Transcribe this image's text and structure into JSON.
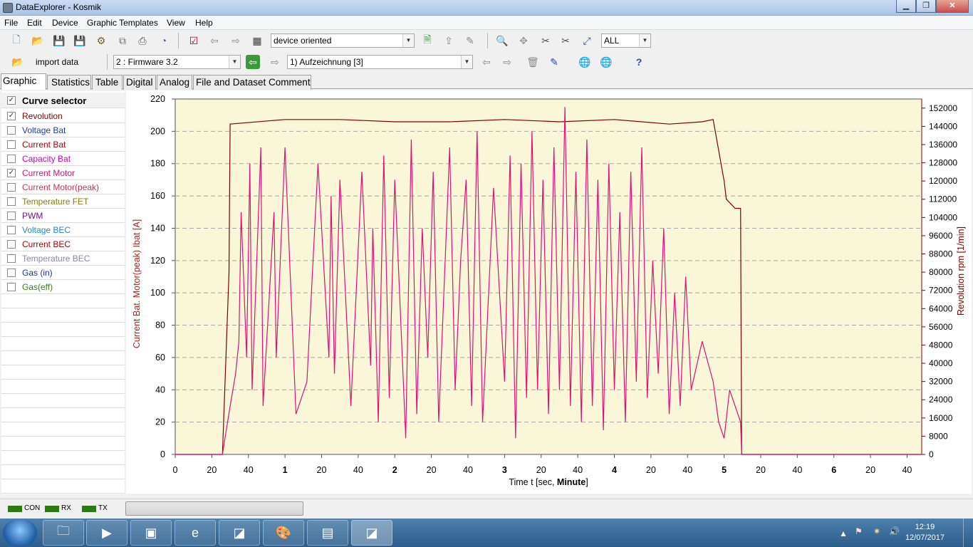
{
  "window": {
    "title": "DataExplorer  -  Kosmik",
    "minimize": "▁",
    "maximize": "❐",
    "close": "✕"
  },
  "menu": [
    "File",
    "Edit",
    "Device",
    "Graphic Templates",
    "View",
    "Help"
  ],
  "toolbar": {
    "device_mode": "device oriented",
    "zoom_filter": "ALL",
    "import_label": "import data",
    "channel": "2 : Firmware 3.2",
    "record": "1) Aufzeichnung [3]"
  },
  "tabs": [
    "Graphic",
    "Statistics",
    "Table",
    "Digital",
    "Analog",
    "File and Dataset Comment"
  ],
  "curve_selector": {
    "header": "Curve selector",
    "items": [
      {
        "label": "Revolution",
        "checked": true,
        "color": "#7f0000"
      },
      {
        "label": "Voltage Bat",
        "checked": false,
        "color": "#1c3bb5"
      },
      {
        "label": "Current Bat",
        "checked": false,
        "color": "#b00000"
      },
      {
        "label": "Capacity Bat",
        "checked": false,
        "color": "#d000c0"
      },
      {
        "label": "Current Motor",
        "checked": true,
        "color": "#cc1177"
      },
      {
        "label": "Current Motor(peak)",
        "checked": false,
        "color": "#cc3355"
      },
      {
        "label": "Temperature FET",
        "checked": false,
        "color": "#8a7a10"
      },
      {
        "label": "PWM",
        "checked": false,
        "color": "#7a1090"
      },
      {
        "label": "Voltage BEC",
        "checked": false,
        "color": "#2288cc"
      },
      {
        "label": "Current BEC",
        "checked": false,
        "color": "#b00000"
      },
      {
        "label": "Temperature BEC",
        "checked": false,
        "color": "#8888a8"
      },
      {
        "label": "Gas (in)",
        "checked": false,
        "color": "#203090"
      },
      {
        "label": "Gas(eff)",
        "checked": false,
        "color": "#3c7a1a"
      }
    ]
  },
  "chart_data": {
    "type": "line",
    "xlabel": "Time   t   [sec,",
    "xlabel_unit": "Minute",
    "xlabel_end": "]",
    "ylabel_left": "Current Bat. Motor(peak)  Ibat  [A]",
    "ylabel_right": "Revolution  rpm  [1/min]",
    "x_ticks": [
      "0",
      "20",
      "40",
      "1",
      "20",
      "40",
      "2",
      "20",
      "40",
      "3",
      "20",
      "40",
      "4",
      "20",
      "40",
      "5",
      "20",
      "40",
      "6",
      "20",
      "40"
    ],
    "x_tick_bold": [
      false,
      false,
      false,
      true,
      false,
      false,
      true,
      false,
      false,
      true,
      false,
      false,
      true,
      false,
      false,
      true,
      false,
      false,
      true,
      false,
      false
    ],
    "xlim": [
      0,
      6.8
    ],
    "ylim_left": [
      0,
      220
    ],
    "y_ticks_left": [
      0,
      20,
      40,
      60,
      80,
      100,
      120,
      140,
      160,
      180,
      200,
      220
    ],
    "ylim_right": [
      0,
      156000
    ],
    "y_ticks_right": [
      0,
      8000,
      16000,
      24000,
      32000,
      40000,
      48000,
      56000,
      64000,
      72000,
      80000,
      88000,
      96000,
      104000,
      112000,
      120000,
      128000,
      136000,
      144000,
      152000
    ],
    "background": "#faf7d8",
    "grid": "horizontal dashed",
    "series": [
      {
        "name": "Revolution",
        "axis": "right",
        "color": "#7f0000",
        "x": [
          0,
          0.43,
          0.49,
          0.5,
          1.0,
          1.5,
          2.0,
          2.5,
          3.0,
          3.5,
          4.0,
          4.5,
          4.8,
          4.9,
          5.0,
          5.02,
          5.1,
          5.15,
          5.16,
          6.8
        ],
        "y": [
          0,
          0,
          80000,
          145000,
          147000,
          147000,
          146000,
          146000,
          147000,
          146000,
          147000,
          145000,
          146000,
          147000,
          120000,
          112000,
          108000,
          108000,
          0,
          0
        ]
      },
      {
        "name": "Current Motor",
        "axis": "left",
        "color": "#dd1177",
        "x": [
          0,
          0.43,
          0.5,
          0.55,
          0.58,
          0.6,
          0.65,
          0.68,
          0.7,
          0.78,
          0.8,
          0.9,
          0.92,
          1.0,
          1.1,
          1.2,
          1.3,
          1.4,
          1.42,
          1.45,
          1.5,
          1.6,
          1.7,
          1.78,
          1.8,
          1.85,
          1.9,
          1.95,
          2.0,
          2.1,
          2.15,
          2.2,
          2.25,
          2.3,
          2.35,
          2.4,
          2.5,
          2.55,
          2.6,
          2.65,
          2.7,
          2.75,
          2.8,
          2.9,
          3.0,
          3.05,
          3.1,
          3.15,
          3.2,
          3.25,
          3.3,
          3.35,
          3.4,
          3.45,
          3.5,
          3.55,
          3.6,
          3.65,
          3.7,
          3.75,
          3.8,
          3.85,
          3.9,
          3.95,
          4.0,
          4.05,
          4.1,
          4.15,
          4.2,
          4.25,
          4.3,
          4.35,
          4.4,
          4.45,
          4.5,
          4.55,
          4.6,
          4.65,
          4.7,
          4.8,
          4.9,
          4.95,
          5.0,
          5.05,
          5.1,
          5.15,
          5.16,
          6.8
        ],
        "y": [
          0,
          0,
          30,
          50,
          70,
          150,
          60,
          180,
          40,
          190,
          30,
          150,
          60,
          190,
          25,
          45,
          180,
          60,
          160,
          50,
          170,
          30,
          175,
          55,
          140,
          20,
          185,
          35,
          170,
          10,
          195,
          25,
          140,
          60,
          175,
          20,
          190,
          40,
          120,
          170,
          30,
          200,
          20,
          165,
          45,
          185,
          10,
          180,
          35,
          200,
          40,
          170,
          25,
          190,
          40,
          215,
          30,
          175,
          20,
          195,
          30,
          170,
          15,
          180,
          40,
          150,
          20,
          175,
          45,
          190,
          35,
          120,
          50,
          140,
          25,
          100,
          30,
          110,
          40,
          70,
          45,
          20,
          10,
          40,
          30,
          20,
          0,
          0
        ]
      }
    ]
  },
  "status": {
    "con": "CON",
    "rx": "RX",
    "tx": "TX"
  },
  "taskbar": {
    "time": "12:19",
    "date": "12/07/2017",
    "apps": [
      "folder-app-icon",
      "media-player-icon",
      "office-app-icon",
      "ie-browser-icon",
      "dataexplorer-app-icon",
      "paint-app-icon",
      "photo-viewer-icon",
      "dataexplorer-active-icon"
    ]
  }
}
